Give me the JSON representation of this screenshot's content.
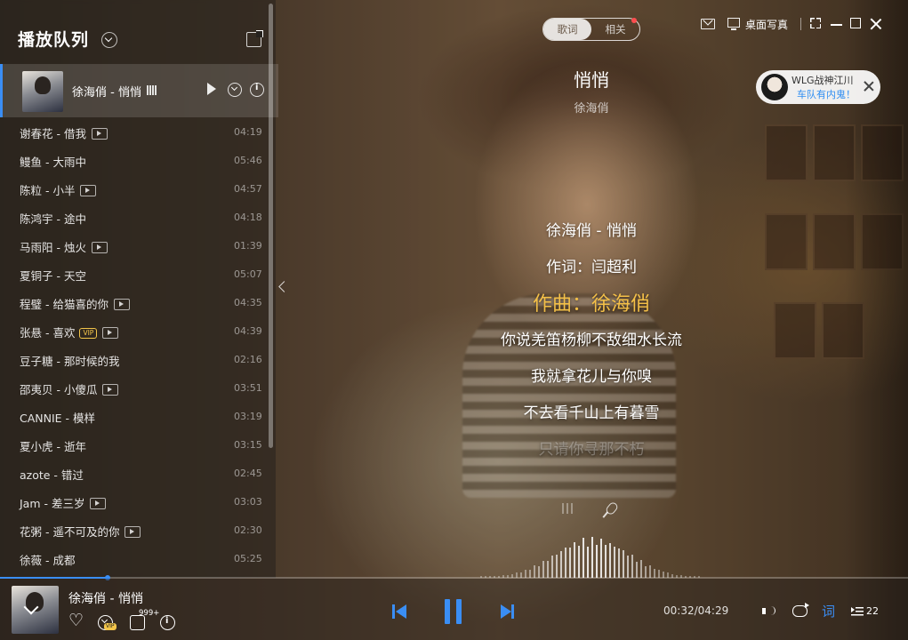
{
  "playlist": {
    "title": "播放队列",
    "current": {
      "label": "徐海俏 - 悄悄"
    },
    "songs": [
      {
        "name": "谢春花 - 借我",
        "duration": "04:19"
      },
      {
        "name": "鳗鱼 - 大雨中",
        "duration": "05:46"
      },
      {
        "name": "陈粒 - 小半",
        "duration": "04:57"
      },
      {
        "name": "陈鸿宇 - 途中",
        "duration": "04:18"
      },
      {
        "name": "马雨阳 - 烛火",
        "duration": "01:39"
      },
      {
        "name": "夏铜子 - 天空",
        "duration": "05:07"
      },
      {
        "name": "程璧 - 给猫喜的你",
        "duration": "04:35"
      },
      {
        "name": "张悬 - 喜欢",
        "duration": "04:39"
      },
      {
        "name": "豆子糖 - 那时候的我",
        "duration": "02:16"
      },
      {
        "name": "邵夷贝 - 小傻瓜",
        "duration": "03:51"
      },
      {
        "name": "CANNIE - 模样",
        "duration": "03:19"
      },
      {
        "name": "夏小虎 - 逝年",
        "duration": "03:15"
      },
      {
        "name": "azote - 错过",
        "duration": "02:45"
      },
      {
        "name": "Jam - 差三岁",
        "duration": "03:03"
      },
      {
        "name": "花粥 - 遥不可及的你",
        "duration": "02:30"
      },
      {
        "name": "徐薇 - 成都",
        "duration": "05:25"
      }
    ],
    "vip_badge": "VIP"
  },
  "header": {
    "tab_lyrics": "歌词",
    "tab_related": "相关",
    "desktop_label": "桌面写真"
  },
  "promo": {
    "name": "WLG战神江川",
    "subtitle": "车队有内鬼！"
  },
  "song": {
    "title": "悄悄",
    "artist": "徐海俏"
  },
  "lyrics": [
    "徐海俏 - 悄悄",
    "作词：闫超利",
    "作曲：徐海俏",
    "你说羌笛杨柳不敌细水长流",
    "我就拿花儿与你嗅",
    "不去看千山上有暮雪",
    "只请你寻那不朽"
  ],
  "player": {
    "now_playing": "徐海俏 - 悄悄",
    "comment_count": "999+",
    "dl_badge": "VIP",
    "time": "00:32/04:29",
    "progress": 0.119,
    "lyric_toggle": "词",
    "queue_count": "22"
  },
  "colors": {
    "accent": "#3a8ef5",
    "active_lyric": "#f4c048",
    "vip": "#f3c54a"
  }
}
